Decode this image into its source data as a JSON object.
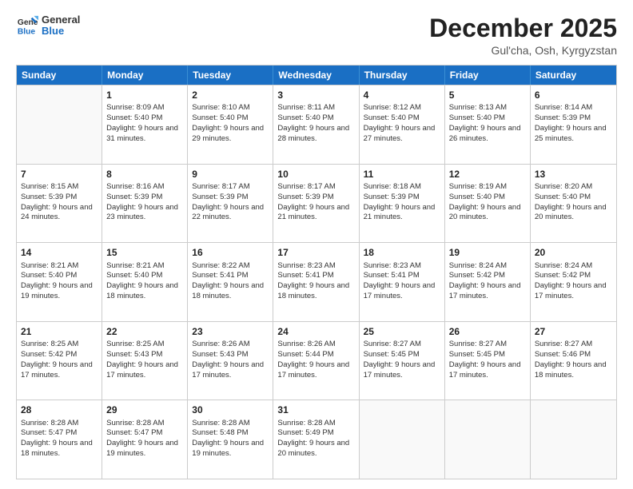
{
  "logo": {
    "line1": "General",
    "line2": "Blue"
  },
  "title": "December 2025",
  "location": "Gul'cha, Osh, Kyrgyzstan",
  "header_days": [
    "Sunday",
    "Monday",
    "Tuesday",
    "Wednesday",
    "Thursday",
    "Friday",
    "Saturday"
  ],
  "weeks": [
    [
      {
        "day": "",
        "sunrise": "",
        "sunset": "",
        "daylight": ""
      },
      {
        "day": "1",
        "sunrise": "Sunrise: 8:09 AM",
        "sunset": "Sunset: 5:40 PM",
        "daylight": "Daylight: 9 hours and 31 minutes."
      },
      {
        "day": "2",
        "sunrise": "Sunrise: 8:10 AM",
        "sunset": "Sunset: 5:40 PM",
        "daylight": "Daylight: 9 hours and 29 minutes."
      },
      {
        "day": "3",
        "sunrise": "Sunrise: 8:11 AM",
        "sunset": "Sunset: 5:40 PM",
        "daylight": "Daylight: 9 hours and 28 minutes."
      },
      {
        "day": "4",
        "sunrise": "Sunrise: 8:12 AM",
        "sunset": "Sunset: 5:40 PM",
        "daylight": "Daylight: 9 hours and 27 minutes."
      },
      {
        "day": "5",
        "sunrise": "Sunrise: 8:13 AM",
        "sunset": "Sunset: 5:40 PM",
        "daylight": "Daylight: 9 hours and 26 minutes."
      },
      {
        "day": "6",
        "sunrise": "Sunrise: 8:14 AM",
        "sunset": "Sunset: 5:39 PM",
        "daylight": "Daylight: 9 hours and 25 minutes."
      }
    ],
    [
      {
        "day": "7",
        "sunrise": "Sunrise: 8:15 AM",
        "sunset": "Sunset: 5:39 PM",
        "daylight": "Daylight: 9 hours and 24 minutes."
      },
      {
        "day": "8",
        "sunrise": "Sunrise: 8:16 AM",
        "sunset": "Sunset: 5:39 PM",
        "daylight": "Daylight: 9 hours and 23 minutes."
      },
      {
        "day": "9",
        "sunrise": "Sunrise: 8:17 AM",
        "sunset": "Sunset: 5:39 PM",
        "daylight": "Daylight: 9 hours and 22 minutes."
      },
      {
        "day": "10",
        "sunrise": "Sunrise: 8:17 AM",
        "sunset": "Sunset: 5:39 PM",
        "daylight": "Daylight: 9 hours and 21 minutes."
      },
      {
        "day": "11",
        "sunrise": "Sunrise: 8:18 AM",
        "sunset": "Sunset: 5:39 PM",
        "daylight": "Daylight: 9 hours and 21 minutes."
      },
      {
        "day": "12",
        "sunrise": "Sunrise: 8:19 AM",
        "sunset": "Sunset: 5:40 PM",
        "daylight": "Daylight: 9 hours and 20 minutes."
      },
      {
        "day": "13",
        "sunrise": "Sunrise: 8:20 AM",
        "sunset": "Sunset: 5:40 PM",
        "daylight": "Daylight: 9 hours and 20 minutes."
      }
    ],
    [
      {
        "day": "14",
        "sunrise": "Sunrise: 8:21 AM",
        "sunset": "Sunset: 5:40 PM",
        "daylight": "Daylight: 9 hours and 19 minutes."
      },
      {
        "day": "15",
        "sunrise": "Sunrise: 8:21 AM",
        "sunset": "Sunset: 5:40 PM",
        "daylight": "Daylight: 9 hours and 18 minutes."
      },
      {
        "day": "16",
        "sunrise": "Sunrise: 8:22 AM",
        "sunset": "Sunset: 5:41 PM",
        "daylight": "Daylight: 9 hours and 18 minutes."
      },
      {
        "day": "17",
        "sunrise": "Sunrise: 8:23 AM",
        "sunset": "Sunset: 5:41 PM",
        "daylight": "Daylight: 9 hours and 18 minutes."
      },
      {
        "day": "18",
        "sunrise": "Sunrise: 8:23 AM",
        "sunset": "Sunset: 5:41 PM",
        "daylight": "Daylight: 9 hours and 17 minutes."
      },
      {
        "day": "19",
        "sunrise": "Sunrise: 8:24 AM",
        "sunset": "Sunset: 5:42 PM",
        "daylight": "Daylight: 9 hours and 17 minutes."
      },
      {
        "day": "20",
        "sunrise": "Sunrise: 8:24 AM",
        "sunset": "Sunset: 5:42 PM",
        "daylight": "Daylight: 9 hours and 17 minutes."
      }
    ],
    [
      {
        "day": "21",
        "sunrise": "Sunrise: 8:25 AM",
        "sunset": "Sunset: 5:42 PM",
        "daylight": "Daylight: 9 hours and 17 minutes."
      },
      {
        "day": "22",
        "sunrise": "Sunrise: 8:25 AM",
        "sunset": "Sunset: 5:43 PM",
        "daylight": "Daylight: 9 hours and 17 minutes."
      },
      {
        "day": "23",
        "sunrise": "Sunrise: 8:26 AM",
        "sunset": "Sunset: 5:43 PM",
        "daylight": "Daylight: 9 hours and 17 minutes."
      },
      {
        "day": "24",
        "sunrise": "Sunrise: 8:26 AM",
        "sunset": "Sunset: 5:44 PM",
        "daylight": "Daylight: 9 hours and 17 minutes."
      },
      {
        "day": "25",
        "sunrise": "Sunrise: 8:27 AM",
        "sunset": "Sunset: 5:45 PM",
        "daylight": "Daylight: 9 hours and 17 minutes."
      },
      {
        "day": "26",
        "sunrise": "Sunrise: 8:27 AM",
        "sunset": "Sunset: 5:45 PM",
        "daylight": "Daylight: 9 hours and 17 minutes."
      },
      {
        "day": "27",
        "sunrise": "Sunrise: 8:27 AM",
        "sunset": "Sunset: 5:46 PM",
        "daylight": "Daylight: 9 hours and 18 minutes."
      }
    ],
    [
      {
        "day": "28",
        "sunrise": "Sunrise: 8:28 AM",
        "sunset": "Sunset: 5:47 PM",
        "daylight": "Daylight: 9 hours and 18 minutes."
      },
      {
        "day": "29",
        "sunrise": "Sunrise: 8:28 AM",
        "sunset": "Sunset: 5:47 PM",
        "daylight": "Daylight: 9 hours and 19 minutes."
      },
      {
        "day": "30",
        "sunrise": "Sunrise: 8:28 AM",
        "sunset": "Sunset: 5:48 PM",
        "daylight": "Daylight: 9 hours and 19 minutes."
      },
      {
        "day": "31",
        "sunrise": "Sunrise: 8:28 AM",
        "sunset": "Sunset: 5:49 PM",
        "daylight": "Daylight: 9 hours and 20 minutes."
      },
      {
        "day": "",
        "sunrise": "",
        "sunset": "",
        "daylight": ""
      },
      {
        "day": "",
        "sunrise": "",
        "sunset": "",
        "daylight": ""
      },
      {
        "day": "",
        "sunrise": "",
        "sunset": "",
        "daylight": ""
      }
    ]
  ]
}
